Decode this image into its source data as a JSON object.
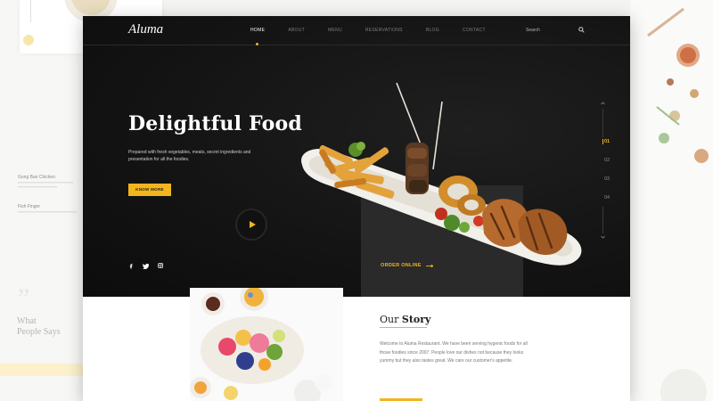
{
  "brand": {
    "logo": "Aluma",
    "accent": "#f2b51b"
  },
  "nav": {
    "items": [
      "HOME",
      "ABOUT",
      "MENU",
      "RESERVATIONS",
      "BLOG",
      "CONTACT"
    ],
    "active_index": 0
  },
  "search": {
    "placeholder": "Search",
    "icon": "search-icon"
  },
  "hero": {
    "title": "Delightful Food",
    "subtitle": "Prepared with fresh vegetables, meats, secret ingredients and presentation for all the foodies.",
    "cta": "KNOW MORE",
    "order_label": "ORDER ONLINE",
    "slides": [
      "01",
      "02",
      "03",
      "04"
    ],
    "active_slide_index": 0,
    "social_icons": [
      "facebook-icon",
      "twitter-icon",
      "instagram-icon"
    ]
  },
  "side_left": {
    "item1_title": "Gong Bao Chicken",
    "item2_title": "Fish Finger",
    "what": "What",
    "people_says": "People Says"
  },
  "story": {
    "title_our": "Our",
    "title_story": "Story",
    "text": "Welcome to Aluma Restaurant. We have been serving hygenic foods for all those foodies since 2007. People love our dishes not because they looks yummy but they also tastes great. We care our customer's appetite."
  }
}
